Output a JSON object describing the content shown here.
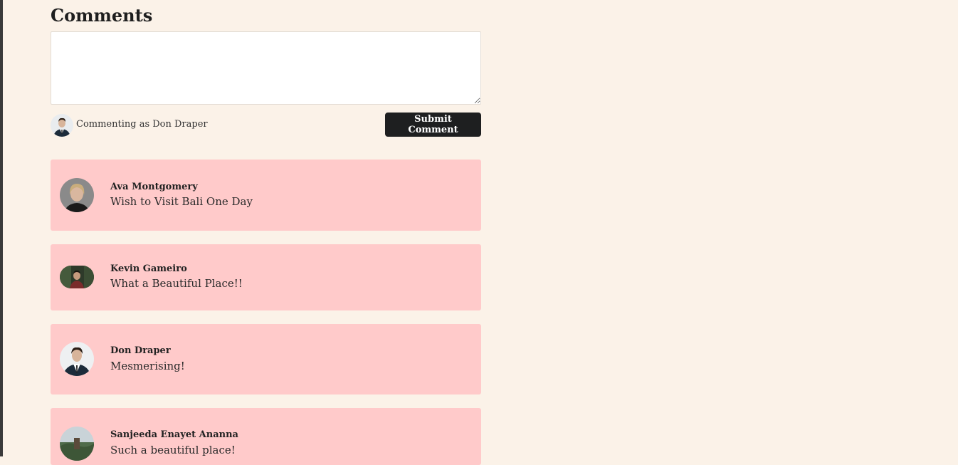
{
  "heading": "Comments",
  "comment_input": {
    "value": "",
    "placeholder": ""
  },
  "current_user": {
    "commenting_label": "Commenting as Don Draper"
  },
  "submit_label": "Submit Comment",
  "comments": [
    {
      "name": "Ava Montgomery",
      "text": "Wish to Visit Bali One Day"
    },
    {
      "name": "Kevin Gameiro",
      "text": "What a Beautiful Place!!"
    },
    {
      "name": "Don Draper",
      "text": "Mesmerising!"
    },
    {
      "name": "Sanjeeda Enayet Ananna",
      "text": "Such a beautiful place!"
    }
  ],
  "colors": {
    "background": "#fbf2e8",
    "card": "#ffcaca",
    "button": "#1e1f20"
  }
}
